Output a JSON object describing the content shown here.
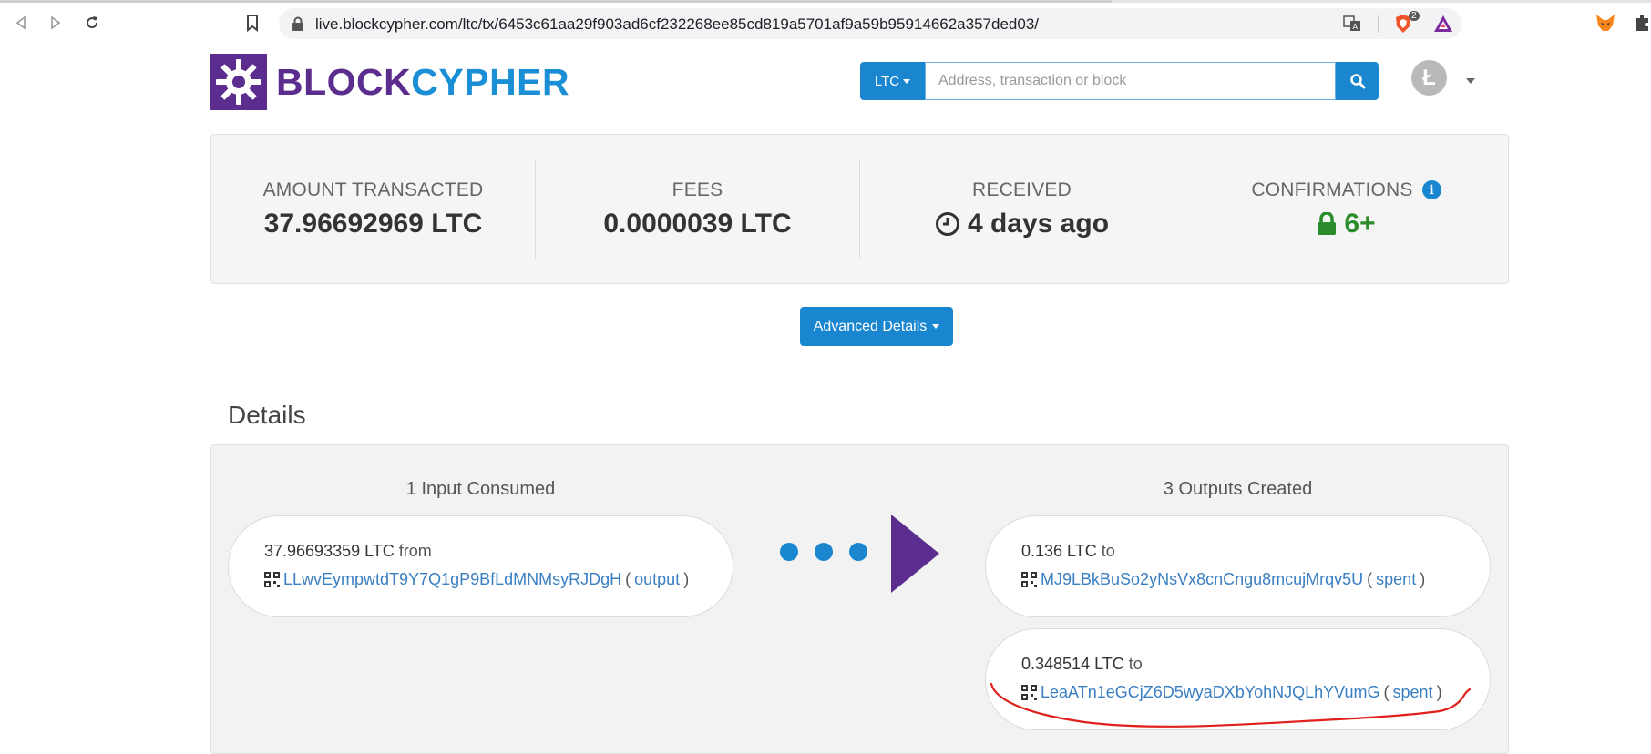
{
  "browser": {
    "url": "live.blockcypher.com/ltc/tx/6453c61aa29f903ad6cf232268ee85cd819a5701af9a59b95914662a357ded03/",
    "brave_badge_count": "2"
  },
  "header": {
    "logo_part1": "BLOCK",
    "logo_part2": "CYPHER",
    "coin_selector": "LTC",
    "search_placeholder": "Address, transaction or block",
    "avatar_letter": "Ł"
  },
  "summary": {
    "amount_label": "AMOUNT TRANSACTED",
    "amount_value": "37.96692969 LTC",
    "fees_label": "FEES",
    "fees_value": "0.0000039 LTC",
    "received_label": "RECEIVED",
    "received_value": "4 days ago",
    "confirmations_label": "CONFIRMATIONS",
    "confirmations_value": "6+"
  },
  "advanced_button": "Advanced Details",
  "details": {
    "title": "Details",
    "inputs_heading": "1 Input Consumed",
    "outputs_heading": "3 Outputs Created",
    "inputs": [
      {
        "amount": "37.96693359 LTC",
        "direction": "from",
        "address": "LLwvEympwtdT9Y7Q1gP9BfLdMNMsyRJDgH",
        "status": "output"
      }
    ],
    "outputs": [
      {
        "amount": "0.136 LTC",
        "direction": "to",
        "address": "MJ9LBkBuSo2yNsVx8cnCngu8mcujMrqv5U",
        "status": "spent"
      },
      {
        "amount": "0.348514 LTC",
        "direction": "to",
        "address": "LeaATn1eGCjZ6D5wyaDXbYohNJQLhYVumG",
        "status": "spent"
      }
    ]
  },
  "colors": {
    "brand_purple": "#5b2d8e",
    "brand_blue": "#1b8fd6",
    "button_blue": "#1a86d0",
    "confirm_green": "#2a8c2a",
    "annotation_red": "#e0201b"
  }
}
